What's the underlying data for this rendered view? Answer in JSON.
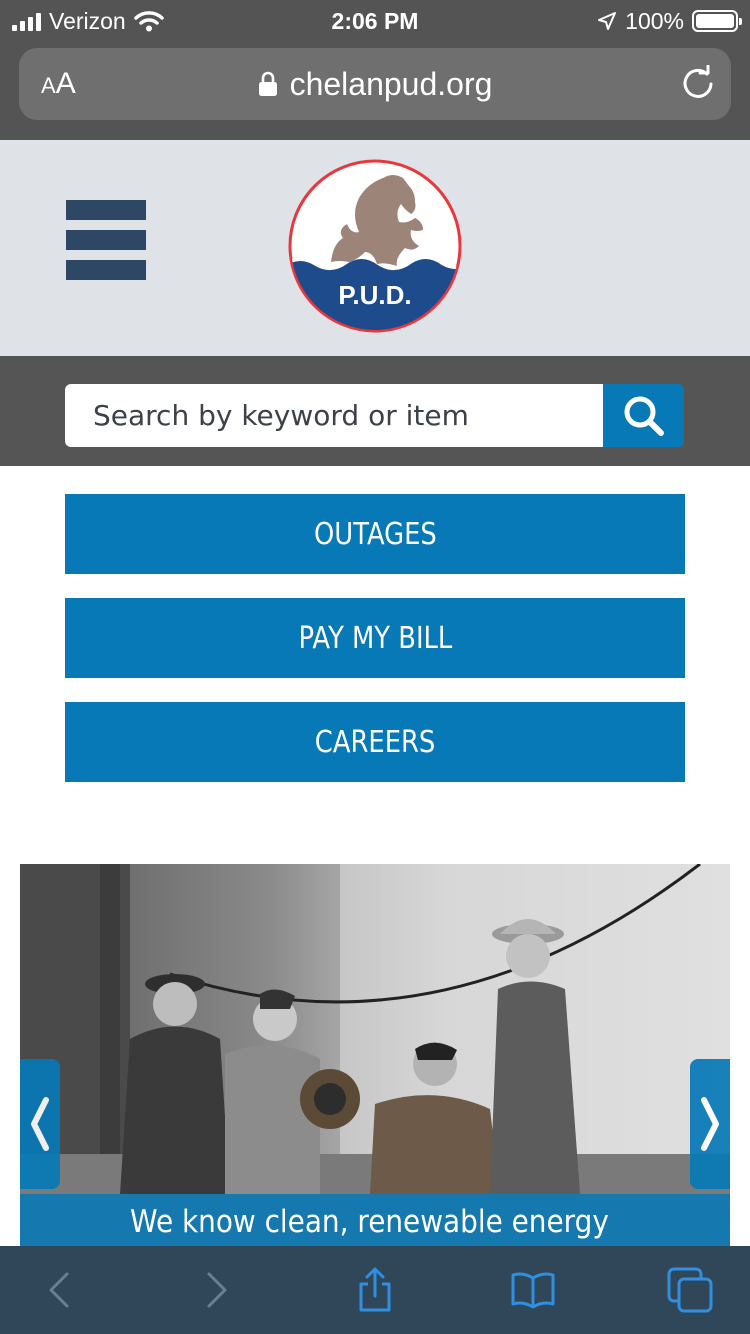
{
  "status_bar": {
    "carrier": "Verizon",
    "time": "2:06 PM",
    "battery": "100%",
    "battery_level": 1.0
  },
  "browser": {
    "text_size_button": {
      "small": "A",
      "large": "A"
    },
    "url": "chelanpud.org"
  },
  "header": {
    "logo_text": "P.U.D."
  },
  "search": {
    "placeholder": "Search by keyword or item"
  },
  "actions": {
    "outages": "OUTAGES",
    "pay_bill": "PAY MY BILL",
    "careers": "CAREERS"
  },
  "slider": {
    "caption": "We know clean, renewable energy",
    "prev_glyph": "❮",
    "next_glyph": "❯"
  },
  "toolbar": {
    "items": [
      "back-icon",
      "forward-icon",
      "share-icon",
      "bookmarks-icon",
      "tabs-icon"
    ]
  },
  "colors": {
    "brand_blue": "#0779b7",
    "header_gray": "#dfe2e6",
    "menu_navy": "#2e4765",
    "chrome_gray": "#545454",
    "toolbar_blue": "#2f4759"
  }
}
